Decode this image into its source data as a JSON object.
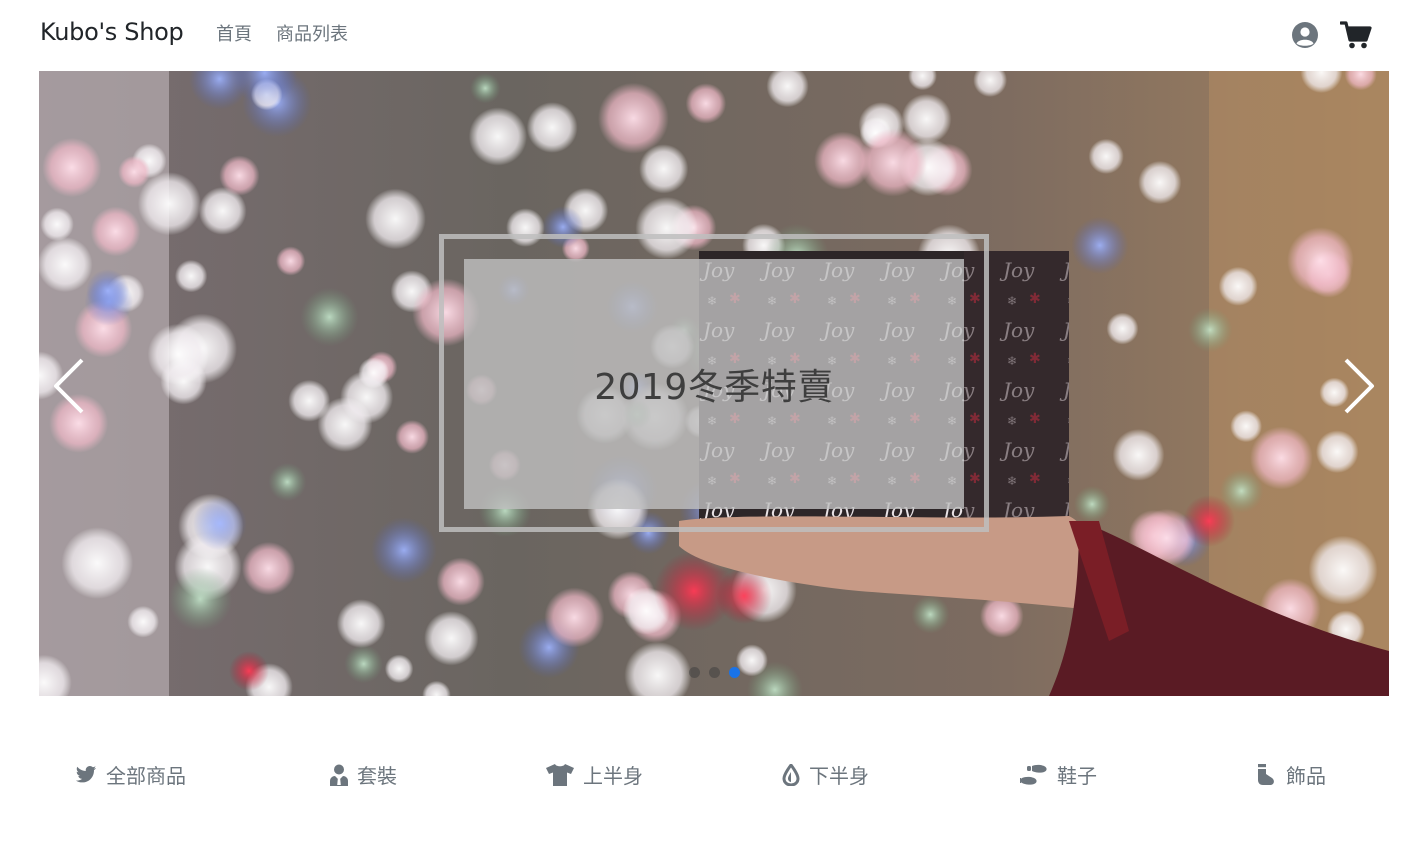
{
  "navbar": {
    "brand": "Kubo's Shop",
    "links": [
      {
        "label": "首頁"
      },
      {
        "label": "商品列表"
      }
    ],
    "icons": {
      "user": "user-circle-icon",
      "cart": "shopping-cart-icon"
    }
  },
  "carousel": {
    "caption": "2019冬季特賣",
    "slide_count": 3,
    "active_index": 2,
    "controls": {
      "prev": "chevron-left-icon",
      "next": "chevron-right-icon"
    }
  },
  "categories": [
    {
      "label": "全部商品",
      "icon": "twitter-bird-icon"
    },
    {
      "label": "套裝",
      "icon": "user-tie-icon"
    },
    {
      "label": "上半身",
      "icon": "tshirt-icon"
    },
    {
      "label": "下半身",
      "icon": "tint-drop-icon"
    },
    {
      "label": "鞋子",
      "icon": "shoe-prints-icon"
    },
    {
      "label": "飾品",
      "icon": "socks-icon"
    }
  ],
  "colors": {
    "accent": "#1a73e8",
    "muted": "#6c757d",
    "dark": "#212529"
  }
}
